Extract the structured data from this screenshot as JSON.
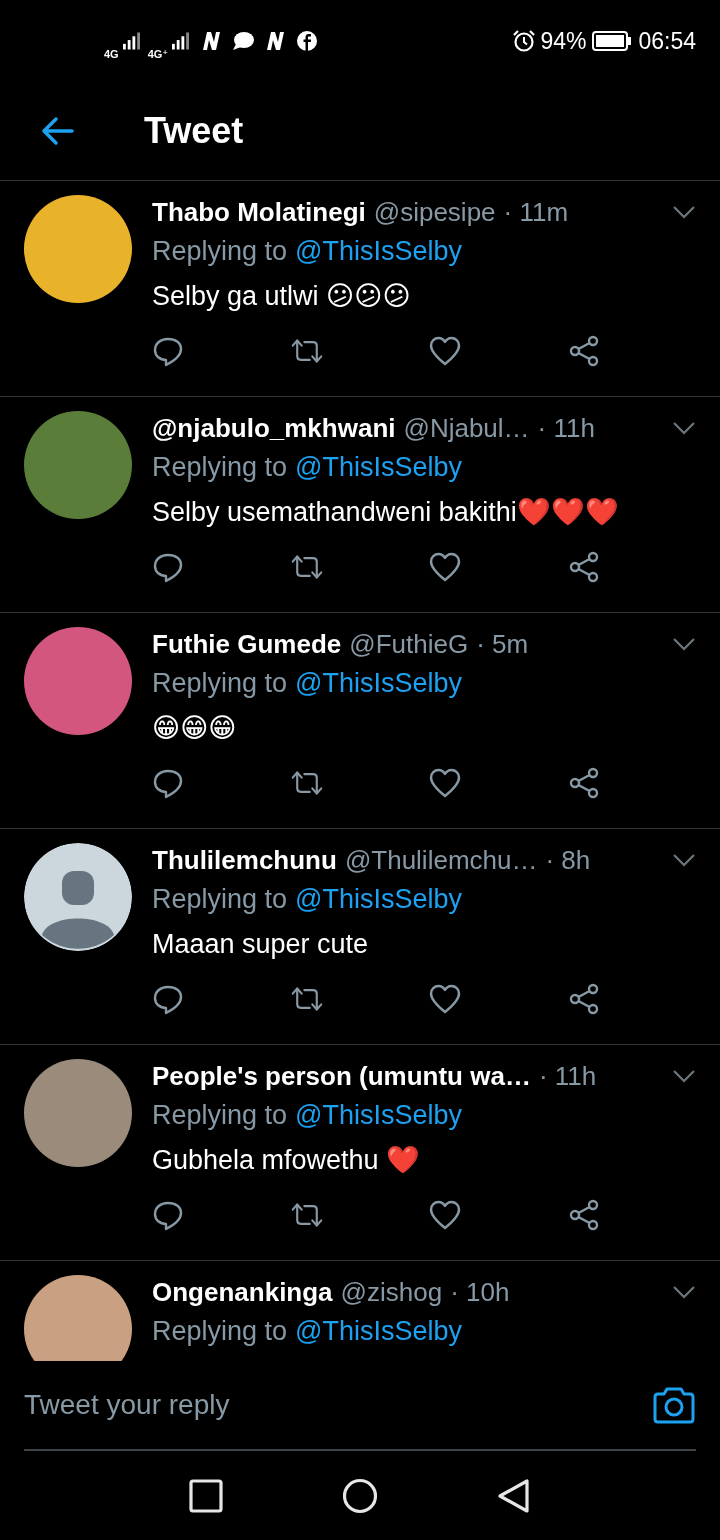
{
  "status_bar": {
    "networks": [
      "4G",
      "4G⁺"
    ],
    "battery": "94%",
    "time": "06:54"
  },
  "header": {
    "title": "Tweet"
  },
  "tweets": [
    {
      "name": "Thabo Molatinegi",
      "handle": "@sipesipe",
      "time": "· 11m",
      "kind": "photo",
      "replying": "Replying to",
      "mention": "@ThisIsSelby",
      "text": "Selby ga utlwi 😕😕😕"
    },
    {
      "name": "@njabulo_mkhwani",
      "handle": "@Njabul…",
      "time": "· 11h",
      "kind": "photo",
      "replying": "Replying to",
      "mention": "@ThisIsSelby",
      "text": "Selby usemathandweni bakithi❤️❤️❤️"
    },
    {
      "name": "Futhie Gumede",
      "handle": "@FuthieG",
      "time": "· 5m",
      "kind": "photo",
      "replying": "Replying to",
      "mention": "@ThisIsSelby",
      "text": "😁😁😁"
    },
    {
      "name": "Thulilemchunu",
      "handle": "@Thulilemchu…",
      "time": "· 8h",
      "kind": "default",
      "replying": "Replying to",
      "mention": "@ThisIsSelby",
      "text": "Maaan super cute"
    },
    {
      "name": "People's person (umuntu wa…",
      "time": "· 11h",
      "kind": "photo",
      "replying": "Replying to",
      "mention": "@ThisIsSelby",
      "text": "Gubhela mfowethu ❤️"
    },
    {
      "name": "Ongenankinga",
      "handle": "@zishog",
      "time": "· 10h",
      "kind": "photo",
      "replying": "Replying to",
      "mention": "@ThisIsSelby"
    }
  ],
  "reply_bar": {
    "placeholder": "Tweet your reply"
  }
}
